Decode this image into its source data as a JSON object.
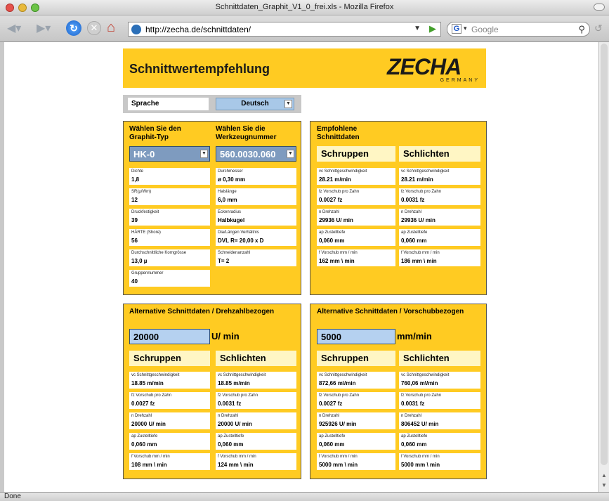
{
  "window": {
    "title": "Schnittdaten_Graphit_V1_0_frei.xls - Mozilla Firefox"
  },
  "toolbar": {
    "url": "http://zecha.de/schnittdaten/",
    "search_placeholder": "Google",
    "search_engine_letter": "G"
  },
  "status": {
    "text": "Done"
  },
  "header": {
    "title": "Schnittwertempfehlung",
    "logo_text": "ZECHA",
    "logo_sub": "GERMANY"
  },
  "language": {
    "label": "Sprache",
    "value": "Deutsch"
  },
  "selection": {
    "col1_heading": "Wählen Sie den Graphit-Typ",
    "col2_heading": "Wählen Sie die Werkzeugnummer",
    "graphite_type": "HK-0",
    "tool_number": "560.0030.060",
    "left_fields": [
      {
        "label": "Dichte",
        "value": "1,8"
      },
      {
        "label": "SR(µ/Wm)",
        "value": "12"
      },
      {
        "label": "Druckfestigkeit",
        "value": "39"
      },
      {
        "label": "HÄRTE (Shore)",
        "value": "56"
      },
      {
        "label": "Durchschnittliche Korngrösse",
        "value": "13,0 µ"
      },
      {
        "label": "Gruppennummer",
        "value": "40"
      }
    ],
    "right_fields": [
      {
        "label": "Durchmesser",
        "value": "ø 0,30 mm"
      },
      {
        "label": "Halslänge",
        "value": "6,0 mm"
      },
      {
        "label": "Eckenradius",
        "value": "Halbkugel"
      },
      {
        "label": "Dia/Längen Verhältnis",
        "value": "DVL R= 20,00  x D"
      },
      {
        "label": "Schneidenanzahl",
        "value": "T=  2"
      }
    ]
  },
  "recommended": {
    "heading": "Empfohlene Schnittdaten",
    "col1": "Schruppen",
    "col2": "Schlichten",
    "col1_fields": [
      {
        "label": "vc Schnittgeschwindigkeit",
        "value": "28.21 m/min"
      },
      {
        "label": "fz Vorschub pro Zahn",
        "value": "0.0027 fz"
      },
      {
        "label": "n Drehzahl",
        "value": "29936 U/ min"
      },
      {
        "label": "ap Zustelltiefe",
        "value": "0,060 mm"
      },
      {
        "label": "f Vorschub mm / min",
        "value": "162 mm \\ min"
      }
    ],
    "col2_fields": [
      {
        "label": "vc Schnittgeschwindigkeit",
        "value": "28.21 m/min"
      },
      {
        "label": "fz Vorschub pro Zahn",
        "value": "0.0031 fz"
      },
      {
        "label": "n Drehzahl",
        "value": "29936 U/ min"
      },
      {
        "label": "ap Zustelltiefe",
        "value": "0,060 mm"
      },
      {
        "label": "f Vorschub mm / min",
        "value": "186 mm \\ min"
      }
    ]
  },
  "alt_rpm": {
    "heading": "Alternative Schnittdaten / Drehzahlbezogen",
    "input_value": "20000",
    "unit": "U/ min",
    "col1": "Schruppen",
    "col2": "Schlichten",
    "col1_fields": [
      {
        "label": "vc Schnittgeschwindigkeit",
        "value": "18.85 m/min"
      },
      {
        "label": "fz Vorschub pro Zahn",
        "value": "0.0027 fz"
      },
      {
        "label": "n Drehzahl",
        "value": "20000 U/ min"
      },
      {
        "label": "ap Zustelltiefe",
        "value": "0,060 mm"
      },
      {
        "label": "f Vorschub mm / min",
        "value": "108 mm \\ min"
      }
    ],
    "col2_fields": [
      {
        "label": "vc Schnittgeschwindigkeit",
        "value": "18.85 m/min"
      },
      {
        "label": "fz Vorschub pro Zahn",
        "value": "0.0031 fz"
      },
      {
        "label": "n Drehzahl",
        "value": "20000 U/ min"
      },
      {
        "label": "ap Zustelltiefe",
        "value": "0,060 mm"
      },
      {
        "label": "f Vorschub mm / min",
        "value": "124 mm \\ min"
      }
    ]
  },
  "alt_feed": {
    "heading": "Alternative Schnittdaten / Vorschubbezogen",
    "input_value": "5000",
    "unit": "mm/min",
    "col1": "Schruppen",
    "col2": "Schlichten",
    "col1_fields": [
      {
        "label": "vc Schnittgeschwindigkeit",
        "value": "872,66 m\\/min"
      },
      {
        "label": "fz Vorschub pro Zahn",
        "value": "0.0027 fz"
      },
      {
        "label": "n Drehzahl",
        "value": "925926 U/ min"
      },
      {
        "label": "ap Zustelltiefe",
        "value": "0,060 mm"
      },
      {
        "label": "f Vorschub mm / min",
        "value": "5000 mm \\ min"
      }
    ],
    "col2_fields": [
      {
        "label": "vc Schnittgeschwindigkeit",
        "value": "760,06 m\\/min"
      },
      {
        "label": "fz Vorschub pro Zahn",
        "value": "0.0031 fz"
      },
      {
        "label": "n Drehzahl",
        "value": "806452 U/ min"
      },
      {
        "label": "ap Zustelltiefe",
        "value": "0,060 mm"
      },
      {
        "label": "f Vorschub mm / min",
        "value": "5000 mm \\ min"
      }
    ]
  }
}
